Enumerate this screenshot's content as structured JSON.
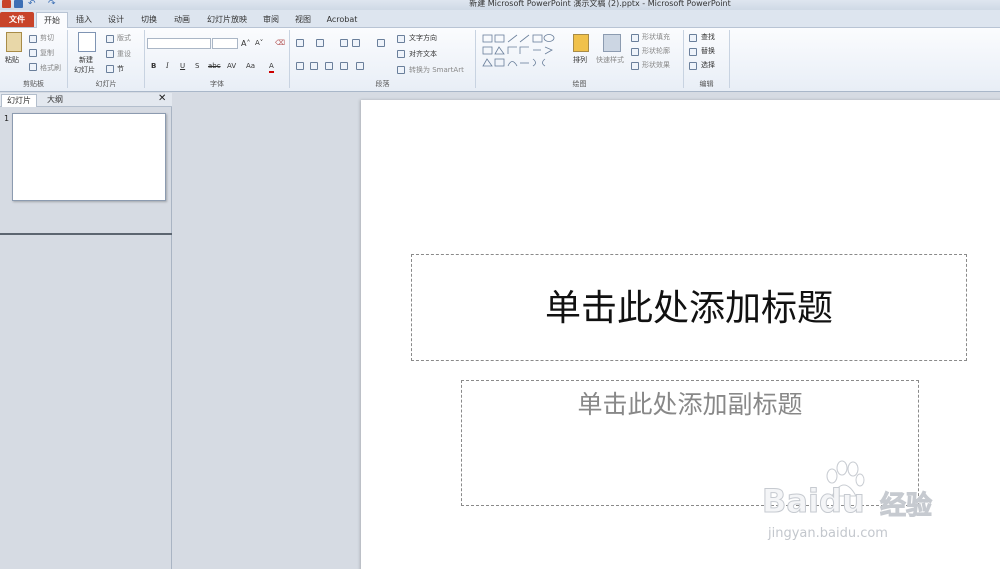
{
  "window": {
    "title": "新建 Microsoft PowerPoint 演示文稿 (2).pptx - Microsoft PowerPoint"
  },
  "tabs": [
    "文件",
    "开始",
    "插入",
    "设计",
    "切换",
    "动画",
    "幻灯片放映",
    "审阅",
    "视图",
    "Acrobat"
  ],
  "clipboard": {
    "paste": "粘贴",
    "cut": "剪切",
    "copy": "复制",
    "format_painter": "格式刷",
    "label": "剪贴板"
  },
  "slides": {
    "new_slide": "新建",
    "new_slide2": "幻灯片",
    "layout": "版式",
    "reset": "重设",
    "section": "节",
    "label": "幻灯片"
  },
  "font": {
    "bold": "B",
    "italic": "I",
    "underline": "U",
    "strike": "S",
    "shadow": "abc",
    "label": "字体"
  },
  "paragraph": {
    "text_direction": "文字方向",
    "align_text": "对齐文本",
    "smartart": "转换为 SmartArt",
    "label": "段落"
  },
  "drawing": {
    "arrange": "排列",
    "quick_styles": "快速样式",
    "shape_fill": "形状填充",
    "shape_outline": "形状轮廓",
    "shape_effects": "形状效果",
    "label": "绘图"
  },
  "editing": {
    "find": "查找",
    "replace": "替换",
    "select": "选择",
    "label": "编辑"
  },
  "panel": {
    "tab_slides": "幻灯片",
    "tab_outline": "大纲",
    "close": "✕",
    "slide_number": "1"
  },
  "slide": {
    "title_placeholder": "单击此处添加标题",
    "subtitle_placeholder": "单击此处添加副标题"
  },
  "watermark": {
    "brand": "Baidu",
    "cn": "经验",
    "url": "jingyan.baidu.com"
  },
  "colors": {
    "file_tab": "#c8442a",
    "ribbon": "#fbfcfe",
    "panel": "#d6dbe3"
  }
}
